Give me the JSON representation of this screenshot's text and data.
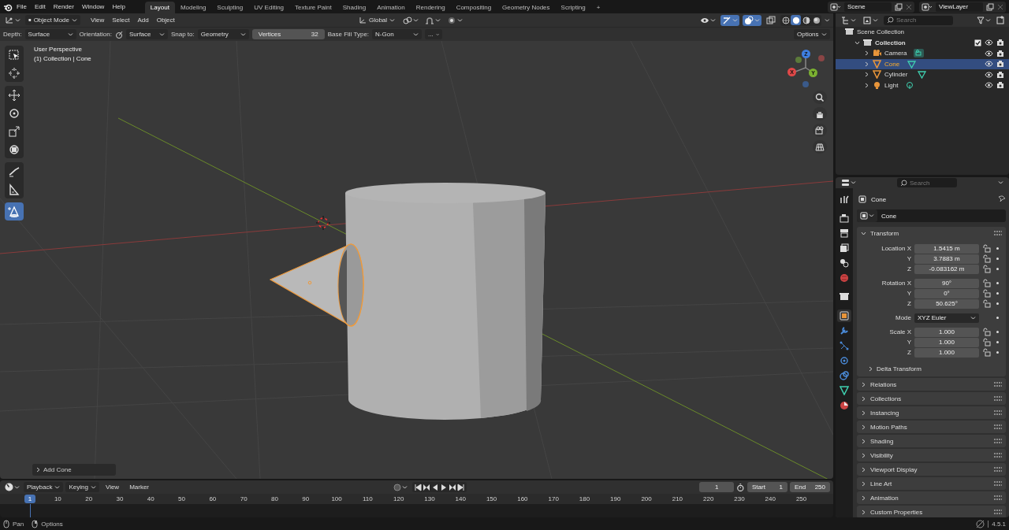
{
  "topbar": {
    "menus": [
      "File",
      "Edit",
      "Render",
      "Window",
      "Help"
    ],
    "workspaces": [
      {
        "label": "Layout",
        "selected": true
      },
      {
        "label": "Modeling",
        "selected": false
      },
      {
        "label": "Sculpting",
        "selected": false
      },
      {
        "label": "UV Editing",
        "selected": false
      },
      {
        "label": "Texture Paint",
        "selected": false
      },
      {
        "label": "Shading",
        "selected": false
      },
      {
        "label": "Animation",
        "selected": false
      },
      {
        "label": "Rendering",
        "selected": false
      },
      {
        "label": "Compositing",
        "selected": false
      },
      {
        "label": "Geometry Nodes",
        "selected": false
      },
      {
        "label": "Scripting",
        "selected": false
      }
    ],
    "add_workspace": "+",
    "scene": "Scene",
    "view_layer": "ViewLayer"
  },
  "viewport_header": {
    "mode": "Object Mode",
    "menus": [
      "View",
      "Select",
      "Add",
      "Object"
    ],
    "orientation": "Global",
    "shading_modes": [
      {
        "kind": "wireframe",
        "selected": false
      },
      {
        "kind": "solid",
        "selected": true
      },
      {
        "kind": "material",
        "selected": false
      },
      {
        "kind": "rendered",
        "selected": false
      }
    ]
  },
  "tool_settings": {
    "dropdowns": [
      {
        "label": "Depth:",
        "value": "Surface",
        "kind": "plain"
      },
      {
        "label": "Orientation:",
        "value": "Surface",
        "kind": "icon"
      },
      {
        "label": "Snap to:",
        "value": "Geometry",
        "kind": "plain"
      }
    ],
    "vertices": {
      "label": "Vertices",
      "value": "32"
    },
    "fill_type": {
      "label": "Base Fill Type:",
      "value": "N-Gon"
    },
    "more": "...",
    "options": "Options"
  },
  "toolbar_groups": [
    {
      "tools": [
        {
          "kind": "select",
          "selected": false
        },
        {
          "kind": "cursor",
          "selected": false
        }
      ]
    },
    {
      "tools": [
        {
          "kind": "move",
          "selected": false
        },
        {
          "kind": "rotate",
          "selected": false
        },
        {
          "kind": "scale",
          "selected": false
        },
        {
          "kind": "transform",
          "selected": false
        }
      ]
    },
    {
      "tools": [
        {
          "kind": "annotate",
          "selected": false
        },
        {
          "kind": "measure",
          "selected": false
        }
      ]
    },
    {
      "tools": [
        {
          "kind": "add_cone",
          "selected": true
        }
      ]
    }
  ],
  "viewport": {
    "view_name": "User Perspective",
    "context": "(1) Collection | Cone",
    "gizmo_axes": [
      "X",
      "Y",
      "Z"
    ],
    "last_operator": "Add Cone"
  },
  "outliner": {
    "search_placeholder": "Search",
    "tree": [
      {
        "name": "Scene Collection",
        "kind": "scene_collection",
        "children": [
          {
            "name": "Collection",
            "kind": "collection",
            "expanded": true,
            "checked": true,
            "children": [
              {
                "name": "Camera",
                "kind": "camera",
                "selected": false,
                "expanded": false
              },
              {
                "name": "Cone",
                "kind": "mesh",
                "selected": true,
                "expanded": false
              },
              {
                "name": "Cylinder",
                "kind": "mesh",
                "selected": false,
                "expanded": false
              },
              {
                "name": "Light",
                "kind": "light",
                "selected": false,
                "expanded": false
              }
            ]
          }
        ]
      }
    ]
  },
  "properties": {
    "search_placeholder": "Search",
    "object_name": "Cone",
    "datablock": "Cone",
    "tabs": [
      {
        "kind": "tool",
        "selected": false
      },
      {
        "kind": "render",
        "selected": false
      },
      {
        "kind": "output",
        "selected": false
      },
      {
        "kind": "view_layer",
        "selected": false
      },
      {
        "kind": "scene",
        "selected": false
      },
      {
        "kind": "world",
        "selected": false
      },
      {
        "kind": "collection",
        "selected": false
      },
      {
        "kind": "object",
        "selected": true
      },
      {
        "kind": "modifiers",
        "selected": false
      },
      {
        "kind": "particles",
        "selected": false
      },
      {
        "kind": "physics",
        "selected": false
      },
      {
        "kind": "constraints",
        "selected": false
      },
      {
        "kind": "data",
        "selected": false
      },
      {
        "kind": "material",
        "selected": false
      }
    ],
    "transform": {
      "title": "Transform",
      "expanded": true,
      "groups": [
        {
          "rows": [
            {
              "label": "Location X",
              "value": "1.5415 m",
              "kind": "number"
            },
            {
              "label": "Y",
              "value": "3.7883 m",
              "kind": "number"
            },
            {
              "label": "Z",
              "value": "-0.083162 m",
              "kind": "number"
            }
          ]
        },
        {
          "rows": [
            {
              "label": "Rotation X",
              "value": "90°",
              "kind": "number"
            },
            {
              "label": "Y",
              "value": "0°",
              "kind": "number"
            },
            {
              "label": "Z",
              "value": "50.625°",
              "kind": "number"
            }
          ]
        },
        {
          "rows": [
            {
              "label": "Mode",
              "value": "XYZ Euler",
              "kind": "dropdown"
            }
          ]
        },
        {
          "rows": [
            {
              "label": "Scale X",
              "value": "1.000",
              "kind": "number"
            },
            {
              "label": "Y",
              "value": "1.000",
              "kind": "number"
            },
            {
              "label": "Z",
              "value": "1.000",
              "kind": "number"
            }
          ]
        }
      ],
      "subpanel": {
        "title": "Delta Transform",
        "expanded": false
      }
    },
    "panels": [
      {
        "title": "Relations",
        "expanded": false
      },
      {
        "title": "Collections",
        "expanded": false
      },
      {
        "title": "Instancing",
        "expanded": false
      },
      {
        "title": "Motion Paths",
        "expanded": false
      },
      {
        "title": "Shading",
        "expanded": false
      },
      {
        "title": "Visibility",
        "expanded": false
      },
      {
        "title": "Viewport Display",
        "expanded": false
      },
      {
        "title": "Line Art",
        "expanded": false
      },
      {
        "title": "Animation",
        "expanded": false
      },
      {
        "title": "Custom Properties",
        "expanded": false
      }
    ]
  },
  "timeline": {
    "menus": [
      "Playback",
      "Keying",
      "View",
      "Marker"
    ],
    "current_frame": "1",
    "frame_field": "1",
    "start": {
      "label": "Start",
      "value": "1"
    },
    "end": {
      "label": "End",
      "value": "250"
    },
    "ticks": [
      "10",
      "20",
      "30",
      "40",
      "50",
      "60",
      "70",
      "80",
      "90",
      "100",
      "110",
      "120",
      "130",
      "140",
      "150",
      "160",
      "170",
      "180",
      "190",
      "200",
      "210",
      "220",
      "230",
      "240",
      "250"
    ]
  },
  "status_bar": {
    "hints": [
      "Pan",
      "Options"
    ],
    "version": "4.5.1"
  }
}
